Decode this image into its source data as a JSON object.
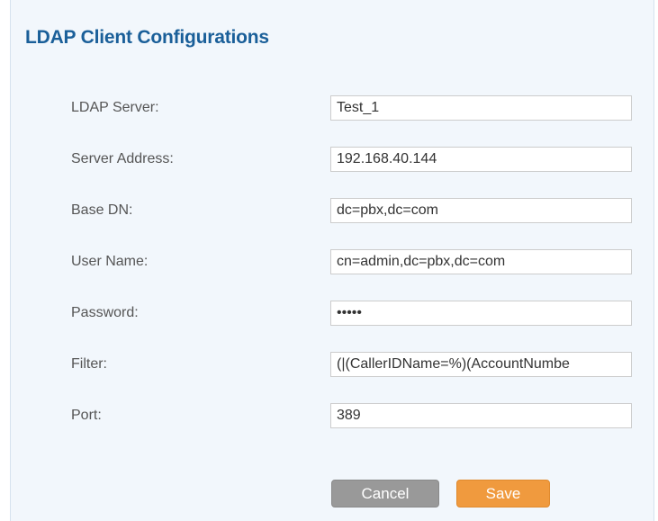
{
  "page": {
    "title": "LDAP Client Configurations"
  },
  "form": {
    "fields": [
      {
        "label": "LDAP Server:",
        "value": "Test_1"
      },
      {
        "label": "Server Address:",
        "value": "192.168.40.144"
      },
      {
        "label": "Base DN:",
        "value": "dc=pbx,dc=com"
      },
      {
        "label": "User Name:",
        "value": "cn=admin,dc=pbx,dc=com"
      },
      {
        "label": "Password:",
        "value": "•••••"
      },
      {
        "label": "Filter:",
        "value": "(|(CallerIDName=%)(AccountNumbe"
      },
      {
        "label": "Port:",
        "value": "389"
      }
    ]
  },
  "actions": {
    "cancel_label": "Cancel",
    "save_label": "Save"
  },
  "colors": {
    "title": "#1a5f99",
    "panel_bg": "#f2f7fc",
    "cancel_bg": "#999999",
    "save_bg": "#f09a3e"
  }
}
